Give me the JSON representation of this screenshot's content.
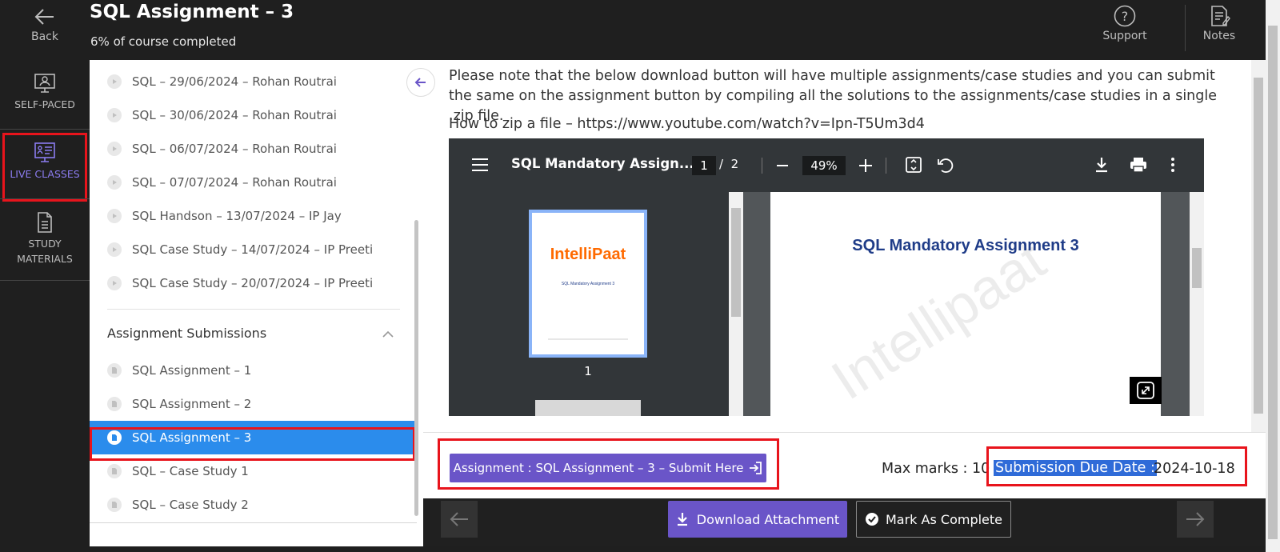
{
  "header": {
    "back_label": "Back",
    "title": "SQL Assignment – 3",
    "subtitle": "6% of course completed",
    "support_label": "Support",
    "notes_label": "Notes"
  },
  "leftnav": {
    "items": [
      {
        "label": "SELF-PACED",
        "icon": "monitor-person-icon"
      },
      {
        "label": "LIVE CLASSES",
        "icon": "presentation-board-icon"
      },
      {
        "label1": "STUDY",
        "label2": "MATERIALS",
        "icon": "document-icon"
      }
    ],
    "accent": "#8b7cf0"
  },
  "sidebar": {
    "live_items": [
      "SQL – 29/06/2024 – Rohan Routrai",
      "SQL – 30/06/2024 – Rohan Routrai",
      "SQL – 06/07/2024 – Rohan Routrai",
      "SQL – 07/07/2024 – Rohan Routrai",
      "SQL Handson – 13/07/2024 – IP Jay",
      "SQL Case Study – 14/07/2024 – IP Preeti",
      "SQL Case Study – 20/07/2024 – IP Preeti"
    ],
    "section_title": "Assignment Submissions",
    "assignment_items": [
      "SQL Assignment – 1",
      "SQL Assignment – 2",
      "SQL Assignment – 3",
      "SQL – Case Study 1",
      "SQL – Case Study 2"
    ],
    "selected_color": "#2b8cec"
  },
  "main": {
    "note": "Please note that the below download button will have multiple assignments/case studies and you can submit the same on the assignment button by compiling all the solutions to the assignments/case studies in a single .zip file.",
    "howto": "How to zip a file – https://www.youtube.com/watch?v=Ipn-T5Um3d4"
  },
  "pdf": {
    "title": "SQL Mandatory Assign...",
    "current_page": "1",
    "total_pages": "2",
    "zoom": "49%",
    "thumb_label": "1",
    "thumb_logo": "IntelliPaat",
    "thumb_caption": "SQL Mandatory Assignment 3",
    "page_title": "SQL Mandatory Assignment 3",
    "watermark": "Intellipaat"
  },
  "submission": {
    "submit_label": "Assignment : SQL Assignment – 3 – Submit Here",
    "max_marks": "Max marks : 10",
    "due_label": "Submission Due Date :",
    "due_value": "2024-10-18"
  },
  "footer": {
    "download_label": "Download Attachment",
    "complete_label": "Mark As Complete",
    "button_color": "#6a55c8"
  }
}
